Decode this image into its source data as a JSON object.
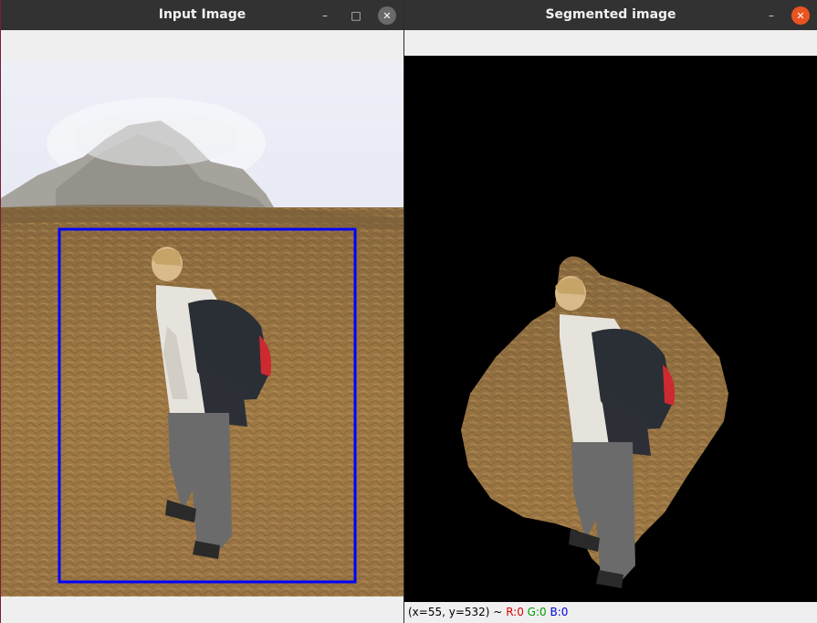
{
  "windows": {
    "input": {
      "title": "Input Image",
      "buttons": {
        "minimize": "–",
        "maximize": "□",
        "close": "✕"
      }
    },
    "segmented": {
      "title": "Segmented image",
      "buttons": {
        "minimize": "–",
        "close": "✕"
      },
      "status": {
        "coords": "(x=55, y=532) ~",
        "r": "R:0",
        "g": "G:0",
        "b": "B:0"
      }
    }
  },
  "colors": {
    "bounding_box": "#0000ff",
    "status_r": "#e00000",
    "status_g": "#00a000",
    "status_b": "#0000e0",
    "close_active": "#e95420"
  },
  "icons": [
    "minimize-icon",
    "maximize-icon",
    "close-icon"
  ]
}
